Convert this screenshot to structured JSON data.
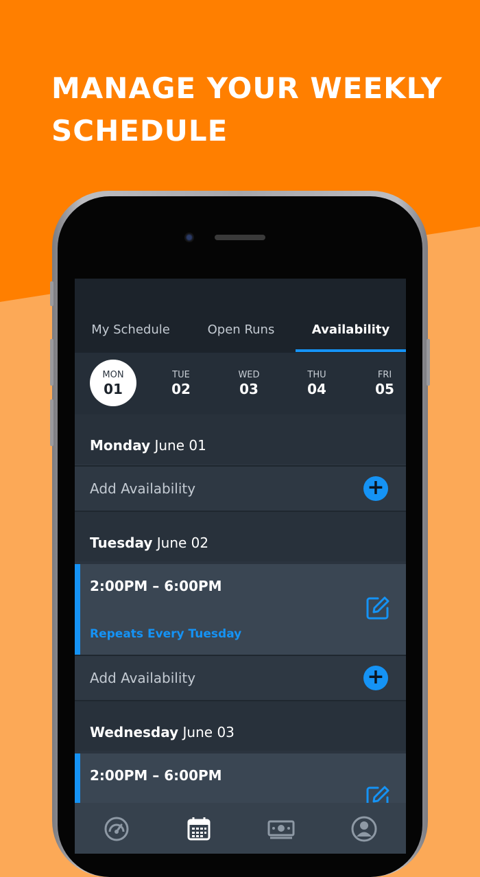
{
  "headline": {
    "line1": "MANAGE YOUR WEEKLY",
    "line2": "SCHEDULE"
  },
  "tabs": [
    {
      "label": "My Schedule",
      "active": false
    },
    {
      "label": "Open Runs",
      "active": false
    },
    {
      "label": "Availability",
      "active": true
    }
  ],
  "days": [
    {
      "name": "MON",
      "num": "01",
      "selected": true
    },
    {
      "name": "TUE",
      "num": "02",
      "selected": false
    },
    {
      "name": "WED",
      "num": "03",
      "selected": false
    },
    {
      "name": "THU",
      "num": "04",
      "selected": false
    },
    {
      "name": "FRI",
      "num": "05",
      "selected": false
    }
  ],
  "sections": [
    {
      "weekday": "Monday",
      "date": "June 01"
    },
    {
      "weekday": "Tuesday",
      "date": "June 02"
    },
    {
      "weekday": "Wednesday",
      "date": "June 03"
    }
  ],
  "add_label": "Add Availability",
  "slots": [
    {
      "time": "2:00PM – 6:00PM",
      "repeat": "Repeats Every Tuesday"
    },
    {
      "time": "2:00PM – 6:00PM",
      "repeat": ""
    }
  ],
  "nav": [
    "dashboard-gauge-icon",
    "calendar-icon",
    "money-icon",
    "profile-icon"
  ],
  "colors": {
    "brand_orange": "#ff7f00",
    "light_orange": "#fca957",
    "accent_blue": "#1593f5",
    "screen_bg": "#2b343f"
  }
}
